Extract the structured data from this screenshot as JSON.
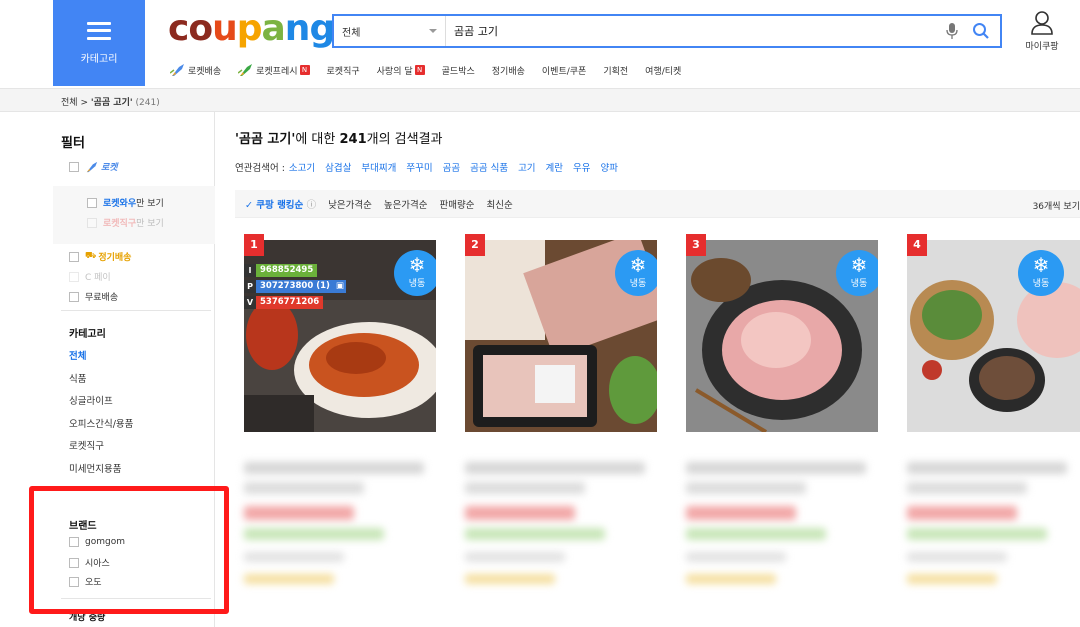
{
  "header": {
    "category_label": "카테고리",
    "logo": {
      "c": "c",
      "o": "o",
      "u": "u",
      "p": "p",
      "a": "a",
      "n": "n",
      "g": "g"
    },
    "search": {
      "scope": "전체",
      "query": "곰곰 고기"
    },
    "mypage_label": "마이쿠팡",
    "subnav": [
      {
        "label": "로켓배송",
        "icon": "rocket-icon"
      },
      {
        "label": "로켓프레시",
        "icon": "rocket-icon",
        "new": "N"
      },
      {
        "label": "로켓직구"
      },
      {
        "label": "사랑의 달",
        "new": "N"
      },
      {
        "label": "골드박스"
      },
      {
        "label": "정기배송"
      },
      {
        "label": "이벤트/쿠폰"
      },
      {
        "label": "기획전"
      },
      {
        "label": "여행/티켓"
      }
    ]
  },
  "breadcrumb": {
    "root": "전체",
    "sep": ">",
    "current": "'곰곰 고기'",
    "count": "(241)"
  },
  "filter": {
    "title": "필터",
    "rocket": "로켓",
    "rocket_wow": "로켓와우",
    "only_view": "만 보기",
    "rocket_direct": "로켓직구",
    "regular": "정기배송",
    "coupay": "C 페이",
    "free_ship": "무료배송",
    "category_title": "카테고리",
    "categories": [
      "전체",
      "식품",
      "싱글라이프",
      "오피스간식/용품",
      "로켓직구",
      "미세먼지용품"
    ],
    "brand_title": "브랜드",
    "brands": [
      "gomgom",
      "시아스",
      "오도"
    ],
    "next_section": "개당 중량"
  },
  "results": {
    "title_q": "'곰곰 고기'",
    "title_mid": "에 대한 ",
    "title_count": "241",
    "title_end": "개의 검색결과",
    "related_label": "연관검색어 :",
    "related": [
      "소고기",
      "삼겹살",
      "부대찌개",
      "쭈꾸미",
      "곰곰",
      "곰곰 식품",
      "고기",
      "계란",
      "우유",
      "양파"
    ],
    "sort": [
      "쿠팡 랭킹순",
      "낮은가격순",
      "높은가격순",
      "판매량순",
      "최신순"
    ],
    "per_page": "36개씩 보기"
  },
  "products": [
    {
      "rank": "1",
      "frozen": "냉동",
      "badges": [
        {
          "k": "I",
          "v": "968852495",
          "color": "#6bb13a"
        },
        {
          "k": "P",
          "v": "307273800 (1)",
          "color": "#3a7bd5"
        },
        {
          "k": "V",
          "v": "5376771206",
          "color": "#e0392b"
        }
      ]
    },
    {
      "rank": "2",
      "frozen": "냉동"
    },
    {
      "rank": "3",
      "frozen": "냉동"
    },
    {
      "rank": "4",
      "frozen": "냉동"
    }
  ],
  "colors": {
    "accent": "#4285f4",
    "rank": "#e62e2e",
    "frozen": "#2b9af3",
    "highlight": "#ff1a1a"
  }
}
